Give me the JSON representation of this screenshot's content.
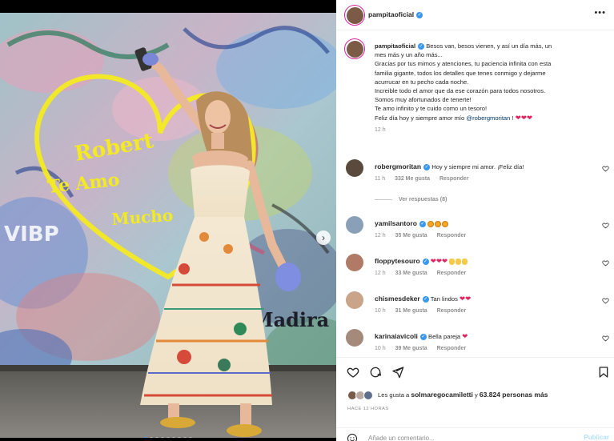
{
  "post": {
    "username": "pampitaoficial",
    "caption_lines": [
      "Besos van, besos vienen, y así un día más, un",
      "mes más y un año más...",
      "Gracias por tus mimos y atenciones, tu paciencia infinita con esta",
      "familia gigante, todos los detalles que tenes conmigo y dejarme",
      "acurrucar en tu pecho cada noche.",
      "Increible todo el amor que da ese corazón para todos nosotros.",
      "Somos muy afortunados de tenerte!",
      "Te amo infinito y te cuido como un tesoro!",
      "Feliz día hoy y siempre amor mío"
    ],
    "caption_mention": "@robergmoritan",
    "caption_suffix": "!",
    "caption_emoji": "❤❤❤",
    "time": "12 h"
  },
  "photo": {
    "graffiti_texts": [
      "Robert",
      "Te Amo",
      "Mucho",
      "Madira",
      "VIBP"
    ],
    "dots_count": 9,
    "active_dot": 0
  },
  "comments": [
    {
      "username": "robergmoritan",
      "verified": true,
      "text": "Hoy y siempre mi amor. ¡Feliz día!",
      "emoji": "",
      "time": "11 h",
      "likes": "332 Me gusta",
      "reply": "Responder",
      "avatar": "#5a4a3e"
    },
    {
      "username": "yamilsantoro",
      "verified": true,
      "text": "",
      "emoji": "face3",
      "time": "12 h",
      "likes": "35 Me gusta",
      "reply": "Responder",
      "avatar": "#8aa0b8"
    },
    {
      "username": "floppytesouro",
      "verified": true,
      "text": "",
      "emoji": "hearts3claps3",
      "time": "12 h",
      "likes": "33 Me gusta",
      "reply": "Responder",
      "avatar": "#b07a66"
    },
    {
      "username": "chismesdeker",
      "verified": true,
      "text": "Tan lindos",
      "emoji": "hearts2",
      "time": "10 h",
      "likes": "31 Me gusta",
      "reply": "Responder",
      "avatar": "#c9a488"
    },
    {
      "username": "karinaiavicoli",
      "verified": true,
      "text": "Bella pareja",
      "emoji": "heart1",
      "time": "10 h",
      "likes": "39 Me gusta",
      "reply": "Responder",
      "avatar": "#a58a7b"
    }
  ],
  "view_replies": "Ver respuestas (8)",
  "likes_text_prefix": "Les gusta a",
  "likes_user": "solmaregocamiletti",
  "likes_text_mid": "y",
  "likes_count": "63.824 personas más",
  "posted_ago": "HACE 12 HORAS",
  "add_comment_placeholder": "Añade un comentario...",
  "publish_label": "Publicar",
  "colors": {
    "verified": "#3897f0",
    "heart": "#e0245e",
    "story_ring": "#d6249f",
    "publish_disabled": "#b2dffc"
  },
  "icons": [
    "more-icon",
    "heart-icon",
    "comment-icon",
    "share-icon",
    "save-icon",
    "smile-icon",
    "chevron-right-icon"
  ]
}
